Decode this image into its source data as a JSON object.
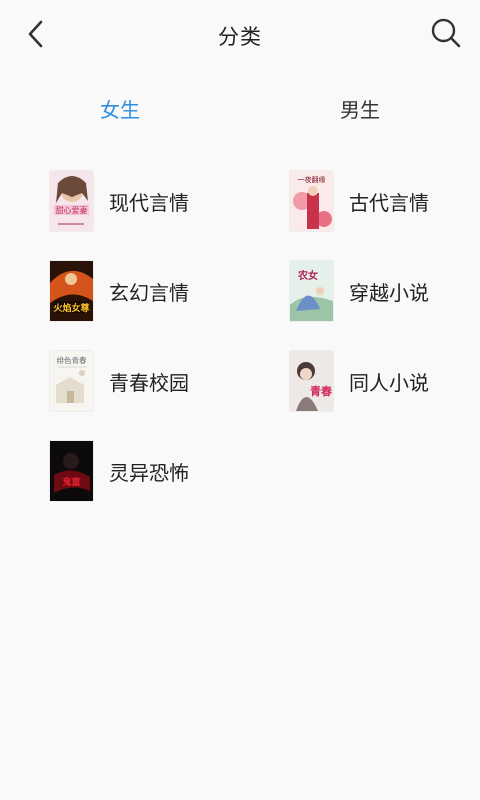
{
  "header": {
    "title": "分类",
    "back_icon": "chevron-left-icon",
    "search_icon": "search-icon"
  },
  "tabs": [
    {
      "label": "女生",
      "active": true
    },
    {
      "label": "男生",
      "active": false
    }
  ],
  "accent_color": "#2d8ee0",
  "categories": [
    {
      "label": "现代言情",
      "cover_title": "甜心爱妻"
    },
    {
      "label": "古代言情",
      "cover_title": "一夜翻缘"
    },
    {
      "label": "玄幻言情",
      "cover_title": "火焰女尊"
    },
    {
      "label": "穿越小说",
      "cover_title": "农女"
    },
    {
      "label": "青春校园",
      "cover_title": "绯色青春"
    },
    {
      "label": "同人小说",
      "cover_title": "青春"
    },
    {
      "label": "灵异恐怖",
      "cover_title": "鬼童"
    }
  ]
}
